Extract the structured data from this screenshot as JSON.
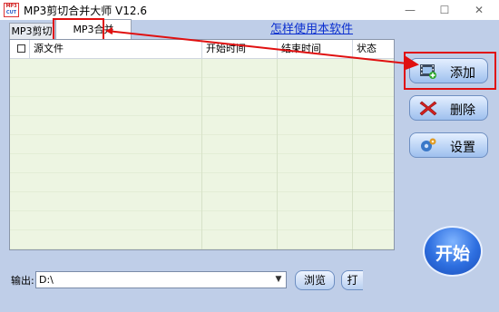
{
  "app": {
    "icon_text_top": "MP3",
    "icon_text_bottom": "CUT",
    "title": "MP3剪切合并大师 V12.6"
  },
  "window_controls": {
    "minimize": "—",
    "maximize": "☐",
    "close": "✕"
  },
  "tabs": [
    {
      "label": "MP3剪切",
      "active": false
    },
    {
      "label": "MP3合并",
      "active": true
    }
  ],
  "help_link": "怎样使用本软件",
  "table": {
    "columns": [
      "源文件",
      "开始时间",
      "结束时间",
      "状态"
    ]
  },
  "side_buttons": {
    "add": "添加",
    "delete": "删除",
    "settings": "设置"
  },
  "start_button": "开始",
  "output": {
    "label": "输出:",
    "path": "D:\\",
    "browse": "浏览",
    "open": "打"
  },
  "colors": {
    "annotation": "#e01010",
    "link": "#0b2fcf",
    "row_bg": "#edf5e2",
    "client_bg": "#bfcee8"
  }
}
